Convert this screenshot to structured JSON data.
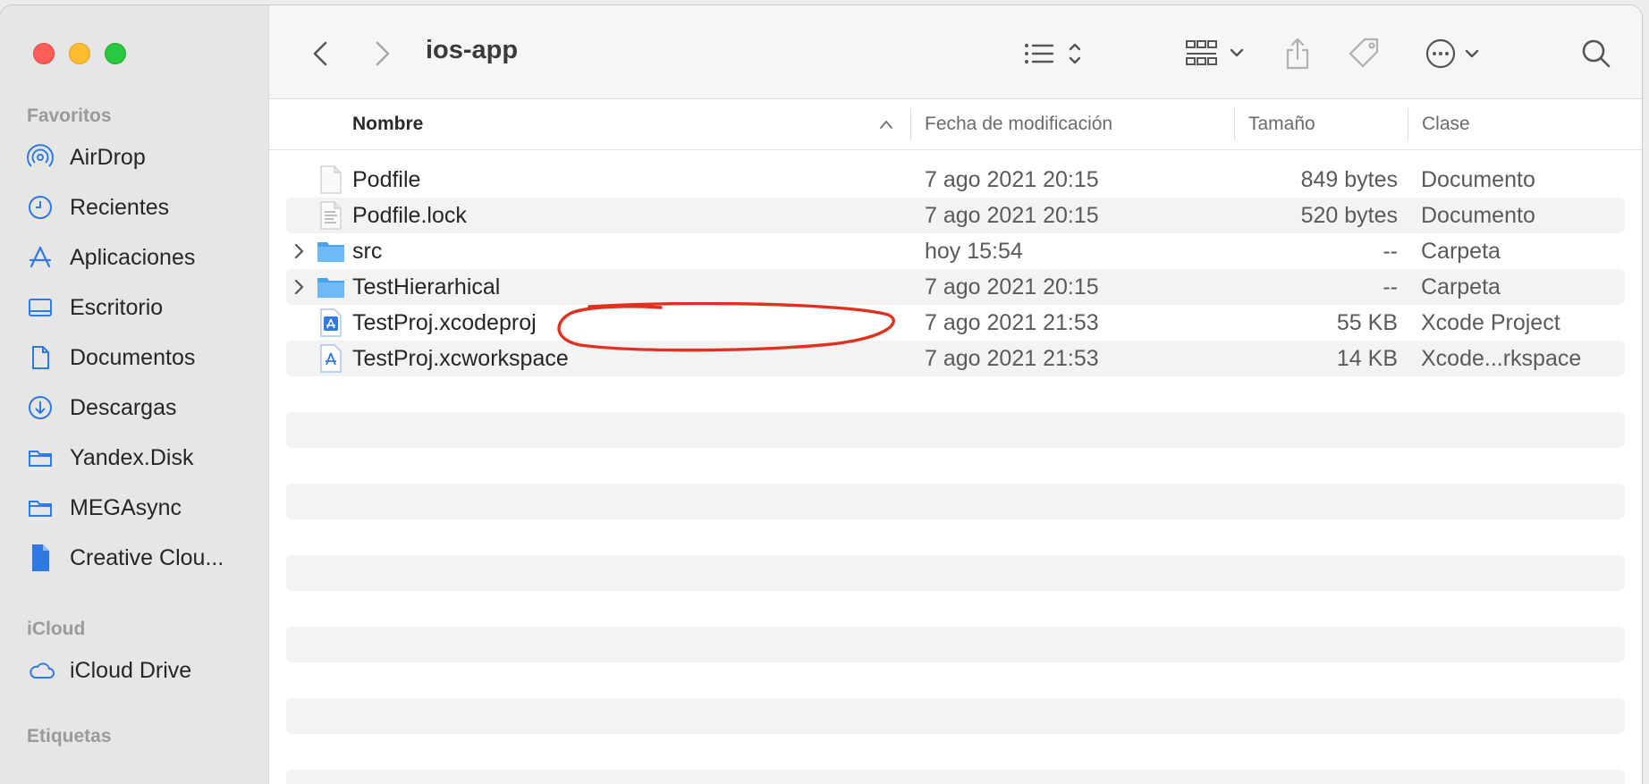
{
  "window": {
    "folder_title": "ios-app"
  },
  "sidebar": {
    "favorites_label": "Favoritos",
    "favorites": [
      {
        "label": "AirDrop",
        "icon": "airdrop-icon"
      },
      {
        "label": "Recientes",
        "icon": "clock-icon"
      },
      {
        "label": "Aplicaciones",
        "icon": "applications-icon"
      },
      {
        "label": "Escritorio",
        "icon": "desktop-icon"
      },
      {
        "label": "Documentos",
        "icon": "document-icon"
      },
      {
        "label": "Descargas",
        "icon": "download-icon"
      },
      {
        "label": "Yandex.Disk",
        "icon": "folder-icon"
      },
      {
        "label": "MEGAsync",
        "icon": "folder-icon"
      },
      {
        "label": "Creative Clou...",
        "icon": "file-icon"
      }
    ],
    "icloud_label": "iCloud",
    "icloud": [
      {
        "label": "iCloud Drive",
        "icon": "cloud-icon"
      }
    ],
    "tags_label": "Etiquetas"
  },
  "columns": {
    "name": "Nombre",
    "date": "Fecha de modificación",
    "size": "Tamaño",
    "kind": "Clase"
  },
  "files": [
    {
      "name": "Podfile",
      "date": "7 ago 2021 20:15",
      "size": "849 bytes",
      "kind": "Documento",
      "icon": "blank-file-icon",
      "folder": false
    },
    {
      "name": "Podfile.lock",
      "date": "7 ago 2021 20:15",
      "size": "520 bytes",
      "kind": "Documento",
      "icon": "text-file-icon",
      "folder": false
    },
    {
      "name": "src",
      "date": "hoy 15:54",
      "size": "--",
      "kind": "Carpeta",
      "icon": "folder-icon",
      "folder": true
    },
    {
      "name": "TestHierarhical",
      "date": "7 ago 2021 20:15",
      "size": "--",
      "kind": "Carpeta",
      "icon": "folder-icon",
      "folder": true
    },
    {
      "name": "TestProj.xcodeproj",
      "date": "7 ago 2021 21:53",
      "size": "55 KB",
      "kind": "Xcode Project",
      "icon": "xcodeproj-icon",
      "folder": false
    },
    {
      "name": "TestProj.xcworkspace",
      "date": "7 ago 2021 21:53",
      "size": "14 KB",
      "kind": "Xcode...rkspace",
      "icon": "xcworkspace-icon",
      "folder": false
    }
  ],
  "colors": {
    "accent": "#2f7ae5",
    "annotation": "#e0301e",
    "folder_blue": "#5aaef0"
  }
}
